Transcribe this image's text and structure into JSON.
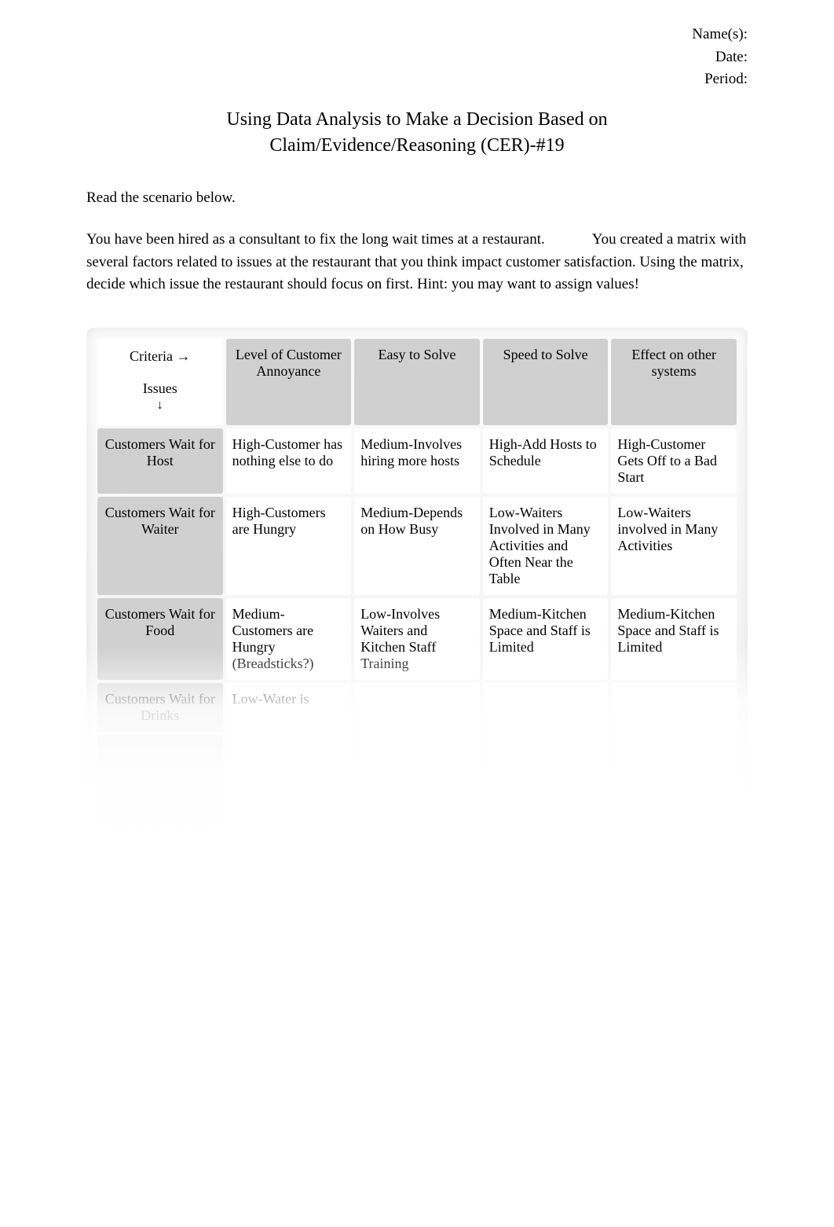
{
  "header": {
    "names_label": "Name(s):",
    "date_label": "Date:",
    "period_label": "Period:"
  },
  "title_line1": "Using Data Analysis to Make a Decision Based on",
  "title_line2": "Claim/Evidence/Reasoning (CER)-#19",
  "instruction": "Read the scenario below.",
  "scenario_part1": "You have been hired as a consultant to fix the long wait times at a restaurant.",
  "scenario_part2": "You created a matrix with several factors related to issues at the restaurant that you think impact customer satisfaction. Using the matrix, decide which issue the restaurant should focus on first. Hint: you may want to assign values!",
  "matrix": {
    "corner": {
      "criteria_label": "Criteria →",
      "issues_label": "Issues",
      "arrow": "↓"
    },
    "columns": [
      "Level of Customer Annoyance",
      "Easy to Solve",
      "Speed to Solve",
      "Effect on other systems"
    ],
    "rows": [
      {
        "issue": "Customers Wait for Host",
        "cells": [
          "High-Customer has nothing else to do",
          "Medium-Involves hiring more hosts",
          "High-Add Hosts to Schedule",
          "High-Customer Gets Off to a Bad Start"
        ]
      },
      {
        "issue": "Customers Wait for Waiter",
        "cells": [
          "High-Customers are Hungry",
          "Medium-Depends on How Busy",
          "Low-Waiters Involved in Many Activities and Often Near the Table",
          "Low-Waiters involved in Many Activities"
        ]
      },
      {
        "issue": "Customers Wait for Food",
        "cells": [
          "Medium-Customers are Hungry (Breadsticks?)",
          "Low-Involves Waiters and Kitchen Staff Training",
          "Medium-Kitchen Space and Staff is Limited",
          "Medium-Kitchen Space and Staff is Limited"
        ]
      },
      {
        "issue": "Customers Wait for Drinks",
        "cells": [
          "Low-Water is",
          "",
          "",
          ""
        ]
      },
      {
        "issue": "",
        "cells": [
          "",
          "",
          "",
          ""
        ]
      },
      {
        "issue": "",
        "cells": [
          "",
          "",
          "",
          ""
        ]
      }
    ]
  }
}
